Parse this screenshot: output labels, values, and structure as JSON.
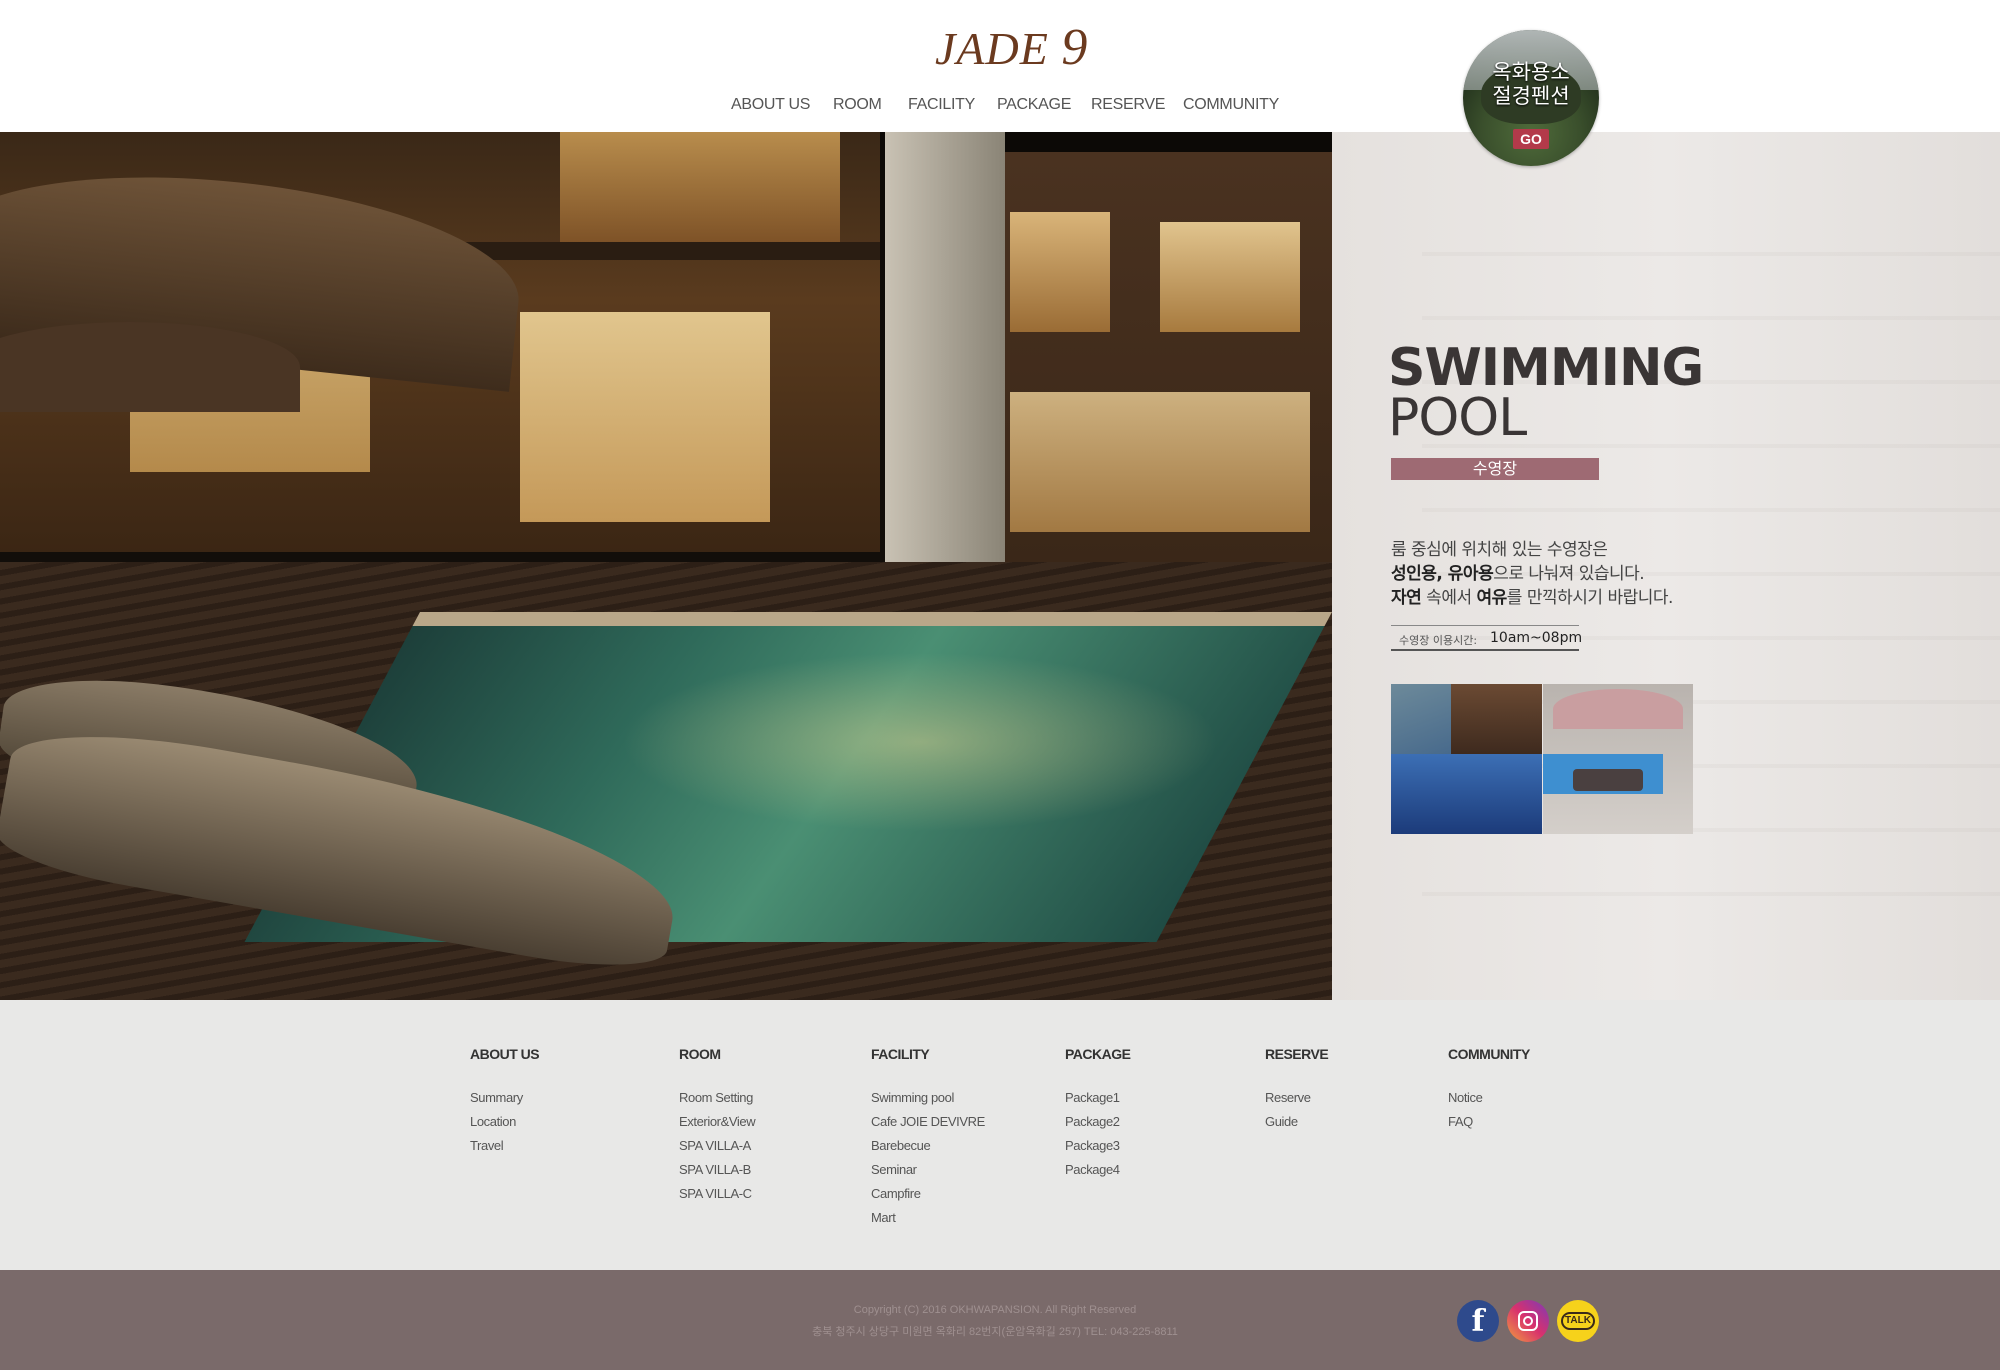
{
  "brand": {
    "logo_text": "JADE",
    "logo_number": "9"
  },
  "nav": {
    "items": [
      "ABOUT US",
      "ROOM",
      "FACILITY",
      "PACKAGE",
      "RESERVE",
      "COMMUNITY"
    ]
  },
  "promo": {
    "title": "옥화용소 절경펜션",
    "go_label": "GO"
  },
  "section": {
    "title_bold": "SWIMMING",
    "title_light": "POOL",
    "korean_label": "수영장",
    "desc_line1": "룸 중심에 위치해 있는 수영장은",
    "desc_line2_b1": "성인용, 유아용",
    "desc_line2_rest": "으로 나눠져 있습니다.",
    "desc_line3_b1": "자연",
    "desc_line3_mid": " 속에서 ",
    "desc_line3_b2": "여유",
    "desc_line3_rest": "를 만끽하시기 바랍니다.",
    "hours_label": "수영장 이용시간:",
    "hours_value": "10am~08pm"
  },
  "footer_menu": {
    "columns": [
      {
        "title": "ABOUT US",
        "items": [
          "Summary",
          "Location",
          "Travel"
        ]
      },
      {
        "title": "ROOM",
        "items": [
          "Room Setting",
          "Exterior&View",
          "SPA VILLA-A",
          "SPA VILLA-B",
          "SPA VILLA-C"
        ]
      },
      {
        "title": "FACILITY",
        "items": [
          "Swimming pool",
          "Cafe JOIE DEVIVRE",
          "Barebecue",
          "Seminar",
          "Campfire",
          "Mart"
        ]
      },
      {
        "title": "PACKAGE",
        "items": [
          "Package1",
          "Package2",
          "Package3",
          "Package4"
        ]
      },
      {
        "title": "RESERVE",
        "items": [
          "Reserve",
          "Guide"
        ]
      },
      {
        "title": "COMMUNITY",
        "items": [
          "Notice",
          "FAQ"
        ]
      }
    ]
  },
  "bottom": {
    "copyright": "Copyright (C) 2016 OKHWAPANSION. All Right Reserved",
    "address": "충북 청주시 상당구 미원면 옥화리 82번지(운암옥화길 257) TEL: 043-225-8811",
    "sns": {
      "facebook": "f",
      "instagram": "instagram-icon",
      "kakao": "TALK"
    }
  },
  "colors": {
    "accent": "#9e6a73",
    "logo": "#6b3a1f",
    "bottom_bar": "#7a6a6a"
  }
}
